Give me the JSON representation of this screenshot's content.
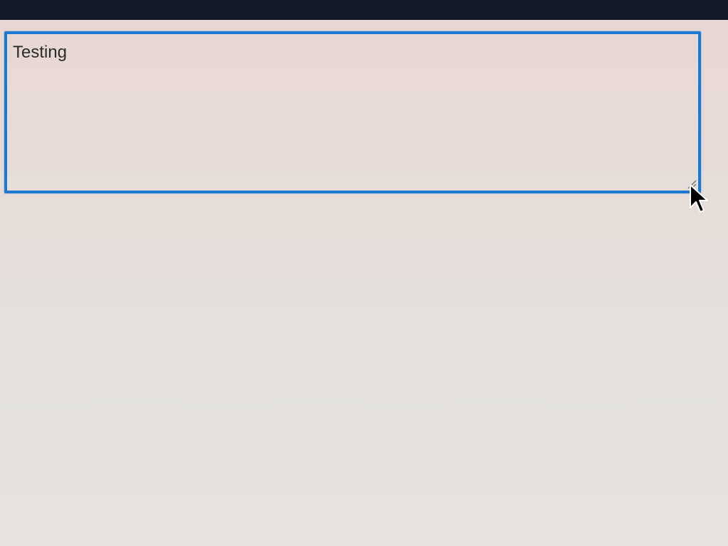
{
  "textarea": {
    "value": "Testing",
    "state": "focused"
  },
  "colors": {
    "top_bar": "#121826",
    "focus_border": "#1d78d2",
    "text": "#2b2b2b",
    "background": "#e6ddd9"
  },
  "icons": {
    "resize_handle": "resize-grip-icon",
    "pointer": "mouse-pointer-icon"
  }
}
